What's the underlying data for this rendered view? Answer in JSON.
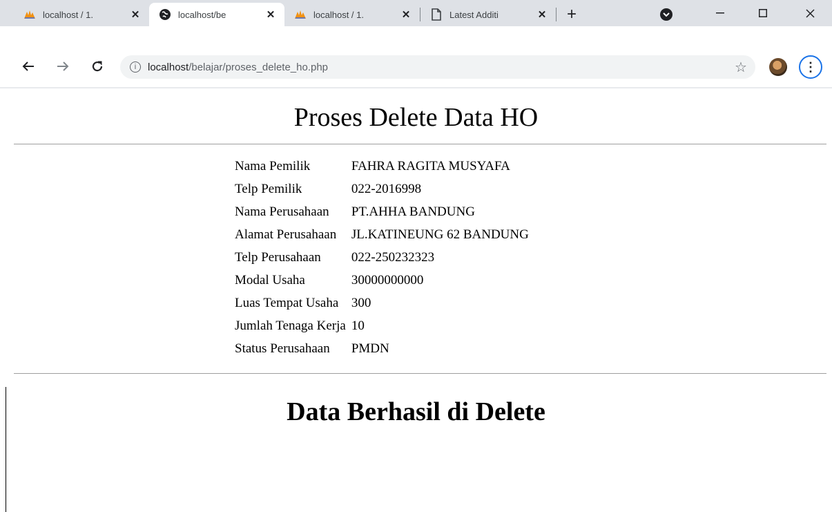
{
  "browser": {
    "tabs": [
      {
        "label": "localhost / 1.",
        "icon": "phpmyadmin-icon",
        "active": false
      },
      {
        "label": "localhost/be",
        "icon": "globe-icon",
        "active": true
      },
      {
        "label": "localhost / 1.",
        "icon": "phpmyadmin-icon",
        "active": false
      },
      {
        "label": "Latest Additi",
        "icon": "document-icon",
        "active": false
      }
    ],
    "close_glyph": "✕",
    "new_tab_glyph": "+",
    "url_host": "localhost",
    "url_path": "/belajar/proses_delete_ho.php",
    "accent_color": "#1a73e8"
  },
  "page": {
    "title": "Proses Delete Data HO",
    "fields": [
      {
        "label": "Nama Pemilik",
        "value": "FAHRA RAGITA MUSYAFA"
      },
      {
        "label": "Telp Pemilik",
        "value": "022-2016998"
      },
      {
        "label": "Nama Perusahaan",
        "value": "PT.AHHA BANDUNG"
      },
      {
        "label": "Alamat Perusahaan",
        "value": "JL.KATINEUNG 62 BANDUNG"
      },
      {
        "label": "Telp Perusahaan",
        "value": "022-250232323"
      },
      {
        "label": "Modal Usaha",
        "value": "30000000000"
      },
      {
        "label": "Luas Tempat Usaha",
        "value": "300"
      },
      {
        "label": "Jumlah Tenaga Kerja",
        "value": "10"
      },
      {
        "label": "Status Perusahaan",
        "value": "PMDN"
      }
    ],
    "result_message": "Data Berhasil di Delete"
  }
}
